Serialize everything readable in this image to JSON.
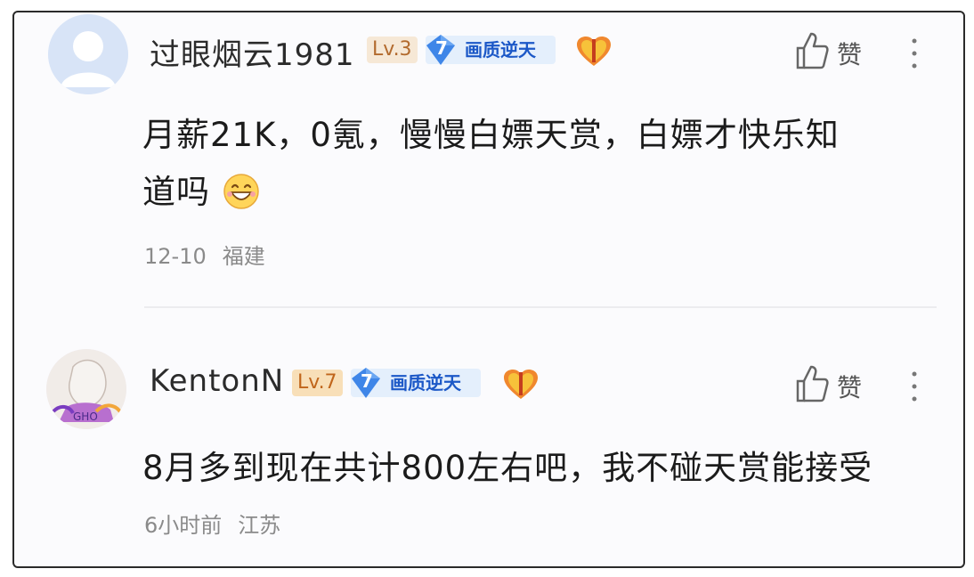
{
  "comments": [
    {
      "username": "过眼烟云1981",
      "level": "Lv.3",
      "badge": {
        "number": "7",
        "text": "画质逆天"
      },
      "like_label": "赞",
      "content_line1": "月薪21K，0氪，慢慢白嫖天赏，白嫖才快乐知",
      "content_line2": "道吗",
      "time": "12-10",
      "location": "福建"
    },
    {
      "username": "KentonN",
      "level": "Lv.7",
      "badge": {
        "number": "7",
        "text": "画质逆天"
      },
      "like_label": "赞",
      "content_line1": "8月多到现在共计800左右吧，我不碰天赏能接受",
      "time": "6小时前",
      "location": "江苏"
    }
  ],
  "icons": {
    "heart": "heart-badge-icon",
    "thumb": "thumbs-up-icon",
    "more": "more-vertical-icon",
    "emoji": "grin-emoji-icon"
  },
  "colors": {
    "badge_bg": "#e4effc",
    "badge_text": "#1c58c7",
    "lv3_text": "#b26a2d",
    "lv7_text": "#c0651b",
    "meta_text": "#8a8a8a"
  }
}
